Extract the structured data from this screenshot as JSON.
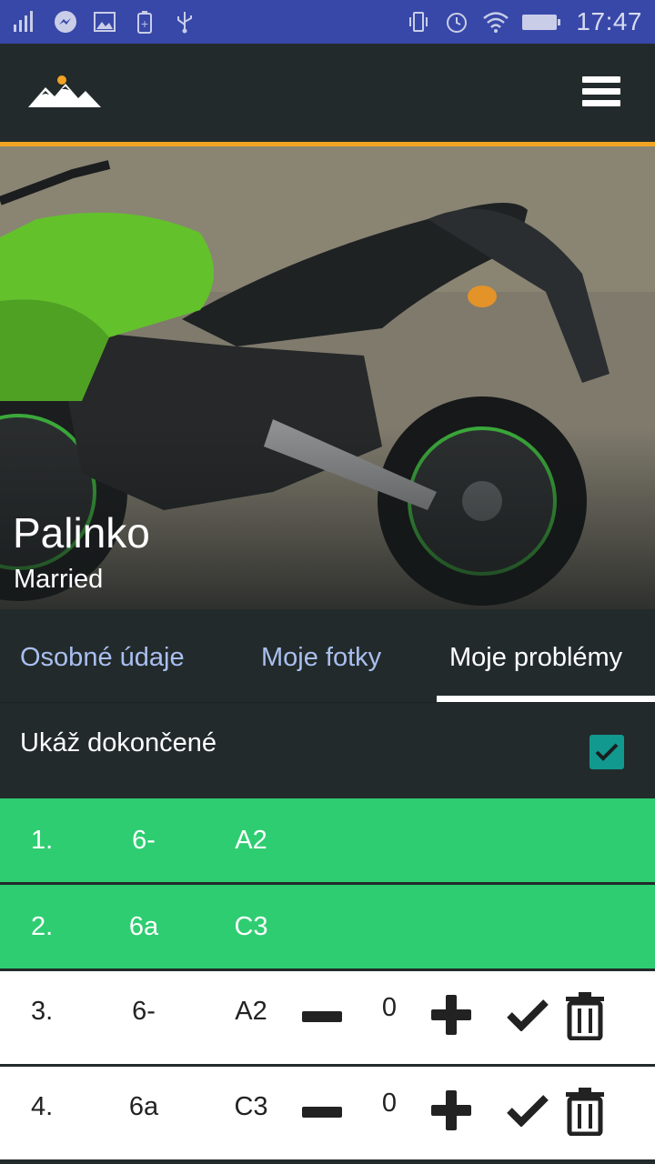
{
  "status_bar": {
    "time": "17:47",
    "left_icons": [
      "signal-icon",
      "messenger-icon",
      "image-icon",
      "battery-saver-icon",
      "usb-icon"
    ],
    "right_icons": [
      "vibrate-icon",
      "alarm-icon",
      "wifi-icon",
      "battery-icon"
    ]
  },
  "colors": {
    "status_bar": "#3748a8",
    "accent": "#f1a422",
    "done_row": "#2ecd71",
    "checkbox": "#12998f",
    "tab_inactive": "#a9bff0"
  },
  "header": {
    "logo": "mountain-logo",
    "menu_icon": "hamburger-menu-icon"
  },
  "profile": {
    "name": "Palinko",
    "status": "Married"
  },
  "tabs": [
    {
      "label": "Osobné údaje",
      "active": false
    },
    {
      "label": "Moje fotky",
      "active": false
    },
    {
      "label": "Moje problémy",
      "active": true
    }
  ],
  "filter": {
    "label": "Ukáž dokončené",
    "checked": true
  },
  "problems": [
    {
      "index": "1.",
      "grade": "6-",
      "hold": "A2",
      "done": true
    },
    {
      "index": "2.",
      "grade": "6a",
      "hold": "C3",
      "done": true
    },
    {
      "index": "3.",
      "grade": "6-",
      "hold": "A2",
      "done": false,
      "count": "0"
    },
    {
      "index": "4.",
      "grade": "6a",
      "hold": "C3",
      "done": false,
      "count": "0"
    }
  ]
}
